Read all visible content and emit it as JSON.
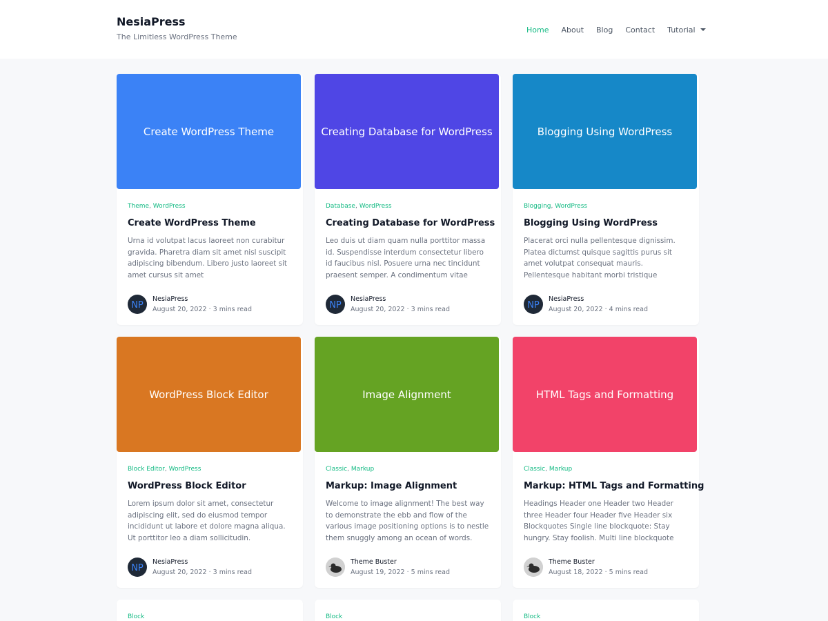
{
  "site": {
    "title": "NesiaPress",
    "tagline": "The Limitless WordPress Theme"
  },
  "nav": {
    "items": [
      {
        "label": "Home",
        "active": true
      },
      {
        "label": "About"
      },
      {
        "label": "Blog"
      },
      {
        "label": "Contact"
      },
      {
        "label": "Tutorial",
        "dropdown": true
      }
    ],
    "active_color": "#10b981"
  },
  "posts": [
    {
      "thumb_text": "Create WordPress Theme",
      "thumb_color": "#3b82f6",
      "categories": [
        "Theme",
        "WordPress"
      ],
      "title": "Create WordPress Theme",
      "excerpt": "Urna id volutpat lacus laoreet non curabitur gravida. Pharetra diam sit amet nisl suscipit adipiscing bibendum. Libero justo laoreet sit amet cursus sit amet",
      "author": "NesiaPress",
      "avatar": "nesiapress-logo-icon",
      "date": "August 20, 2022",
      "read_time": "3 mins read"
    },
    {
      "thumb_text": "Creating Database for WordPress",
      "thumb_color": "#4f46e5",
      "categories": [
        "Database",
        "WordPress"
      ],
      "title": "Creating Database for WordPress",
      "excerpt": "Leo duis ut diam quam nulla porttitor massa id. Suspendisse interdum consectetur libero id faucibus nisl. Posuere urna nec tincidunt praesent semper. A condimentum vitae sapie…",
      "author": "NesiaPress",
      "avatar": "nesiapress-logo-icon",
      "date": "August 20, 2022",
      "read_time": "3 mins read"
    },
    {
      "thumb_text": "Blogging Using WordPress",
      "thumb_color": "#1688c8",
      "categories": [
        "Blogging",
        "WordPress"
      ],
      "title": "Blogging Using WordPress",
      "excerpt": "Placerat orci nulla pellentesque dignissim. Platea dictumst quisque sagittis purus sit amet volutpat consequat mauris. Pellentesque habitant morbi tristique senectus et. Eu non…",
      "author": "NesiaPress",
      "avatar": "nesiapress-logo-icon",
      "date": "August 20, 2022",
      "read_time": "4 mins read"
    },
    {
      "thumb_text": "WordPress Block Editor",
      "thumb_color": "#d97722",
      "categories": [
        "Block Editor",
        "WordPress"
      ],
      "title": "WordPress Block Editor",
      "excerpt": "Lorem ipsum dolor sit amet, consectetur adipiscing elit, sed do eiusmod tempor incididunt ut labore et dolore magna aliqua. Ut porttitor leo a diam sollicitudin.",
      "author": "NesiaPress",
      "avatar": "nesiapress-logo-icon",
      "date": "August 20, 2022",
      "read_time": "3 mins read"
    },
    {
      "thumb_text": "Image Alignment",
      "thumb_color": "#65a323",
      "categories": [
        "Classic",
        "Markup"
      ],
      "title": "Markup: Image Alignment",
      "excerpt": "Welcome to image alignment! The best way to demonstrate the ebb and flow of the various image positioning options is to nestle them snuggly among an ocean of words. Grab a…",
      "author": "Theme Buster",
      "avatar": "bird-avatar-icon",
      "date": "August 19, 2022",
      "read_time": "5 mins read"
    },
    {
      "thumb_text": "HTML Tags and Formatting",
      "thumb_color": "#f24369",
      "categories": [
        "Classic",
        "Markup"
      ],
      "title": "Markup: HTML Tags and Formatting",
      "excerpt": "Headings Header one Header two Header three Header four Header five Header six Blockquotes Single line blockquote: Stay hungry. Stay foolish. Multi line blockquote wi…",
      "author": "Theme Buster",
      "avatar": "bird-avatar-icon",
      "date": "August 18, 2022",
      "read_time": "5 mins read"
    }
  ],
  "partial_posts": [
    {
      "categories": [
        "Block"
      ]
    },
    {
      "categories": [
        "Block"
      ]
    },
    {
      "categories": [
        "Block"
      ]
    }
  ]
}
